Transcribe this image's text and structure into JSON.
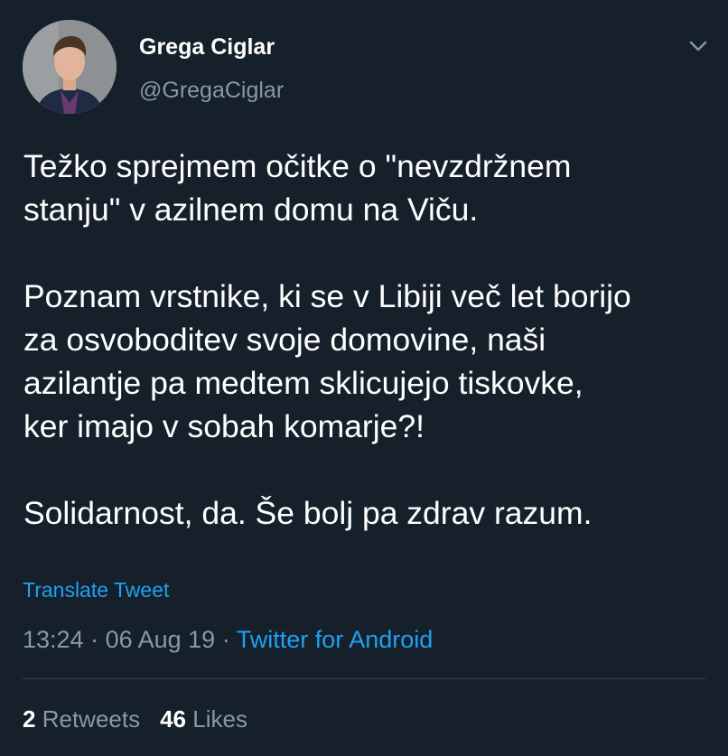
{
  "author": {
    "display_name": "Grega Ciglar",
    "handle": "@GregaCiglar"
  },
  "tweet": {
    "paragraphs": [
      [
        "Težko sprejmem očitke o \"nevzdržnem",
        "stanju\" v azilnem domu na Viču."
      ],
      [
        "Poznam vrstnike, ki se v Libiji več let borijo",
        "za osvoboditev svoje domovine, naši",
        "azilantje pa medtem sklicujejo tiskovke,",
        "ker imajo v sobah komarje?!"
      ],
      [
        "Solidarnost, da. Še bolj pa zdrav razum."
      ]
    ]
  },
  "translate_label": "Translate Tweet",
  "meta": {
    "time": "13:24",
    "separator": " · ",
    "date": "06 Aug 19",
    "source": "Twitter for Android"
  },
  "stats": {
    "retweets_count": "2",
    "retweets_label": "Retweets",
    "likes_count": "46",
    "likes_label": "Likes"
  },
  "icons": {
    "caret": "chevron-down-icon"
  },
  "colors": {
    "background": "#15202b",
    "text": "#ffffff",
    "secondary": "#8899a6",
    "accent": "#1da1f2",
    "divider": "#38444d"
  }
}
